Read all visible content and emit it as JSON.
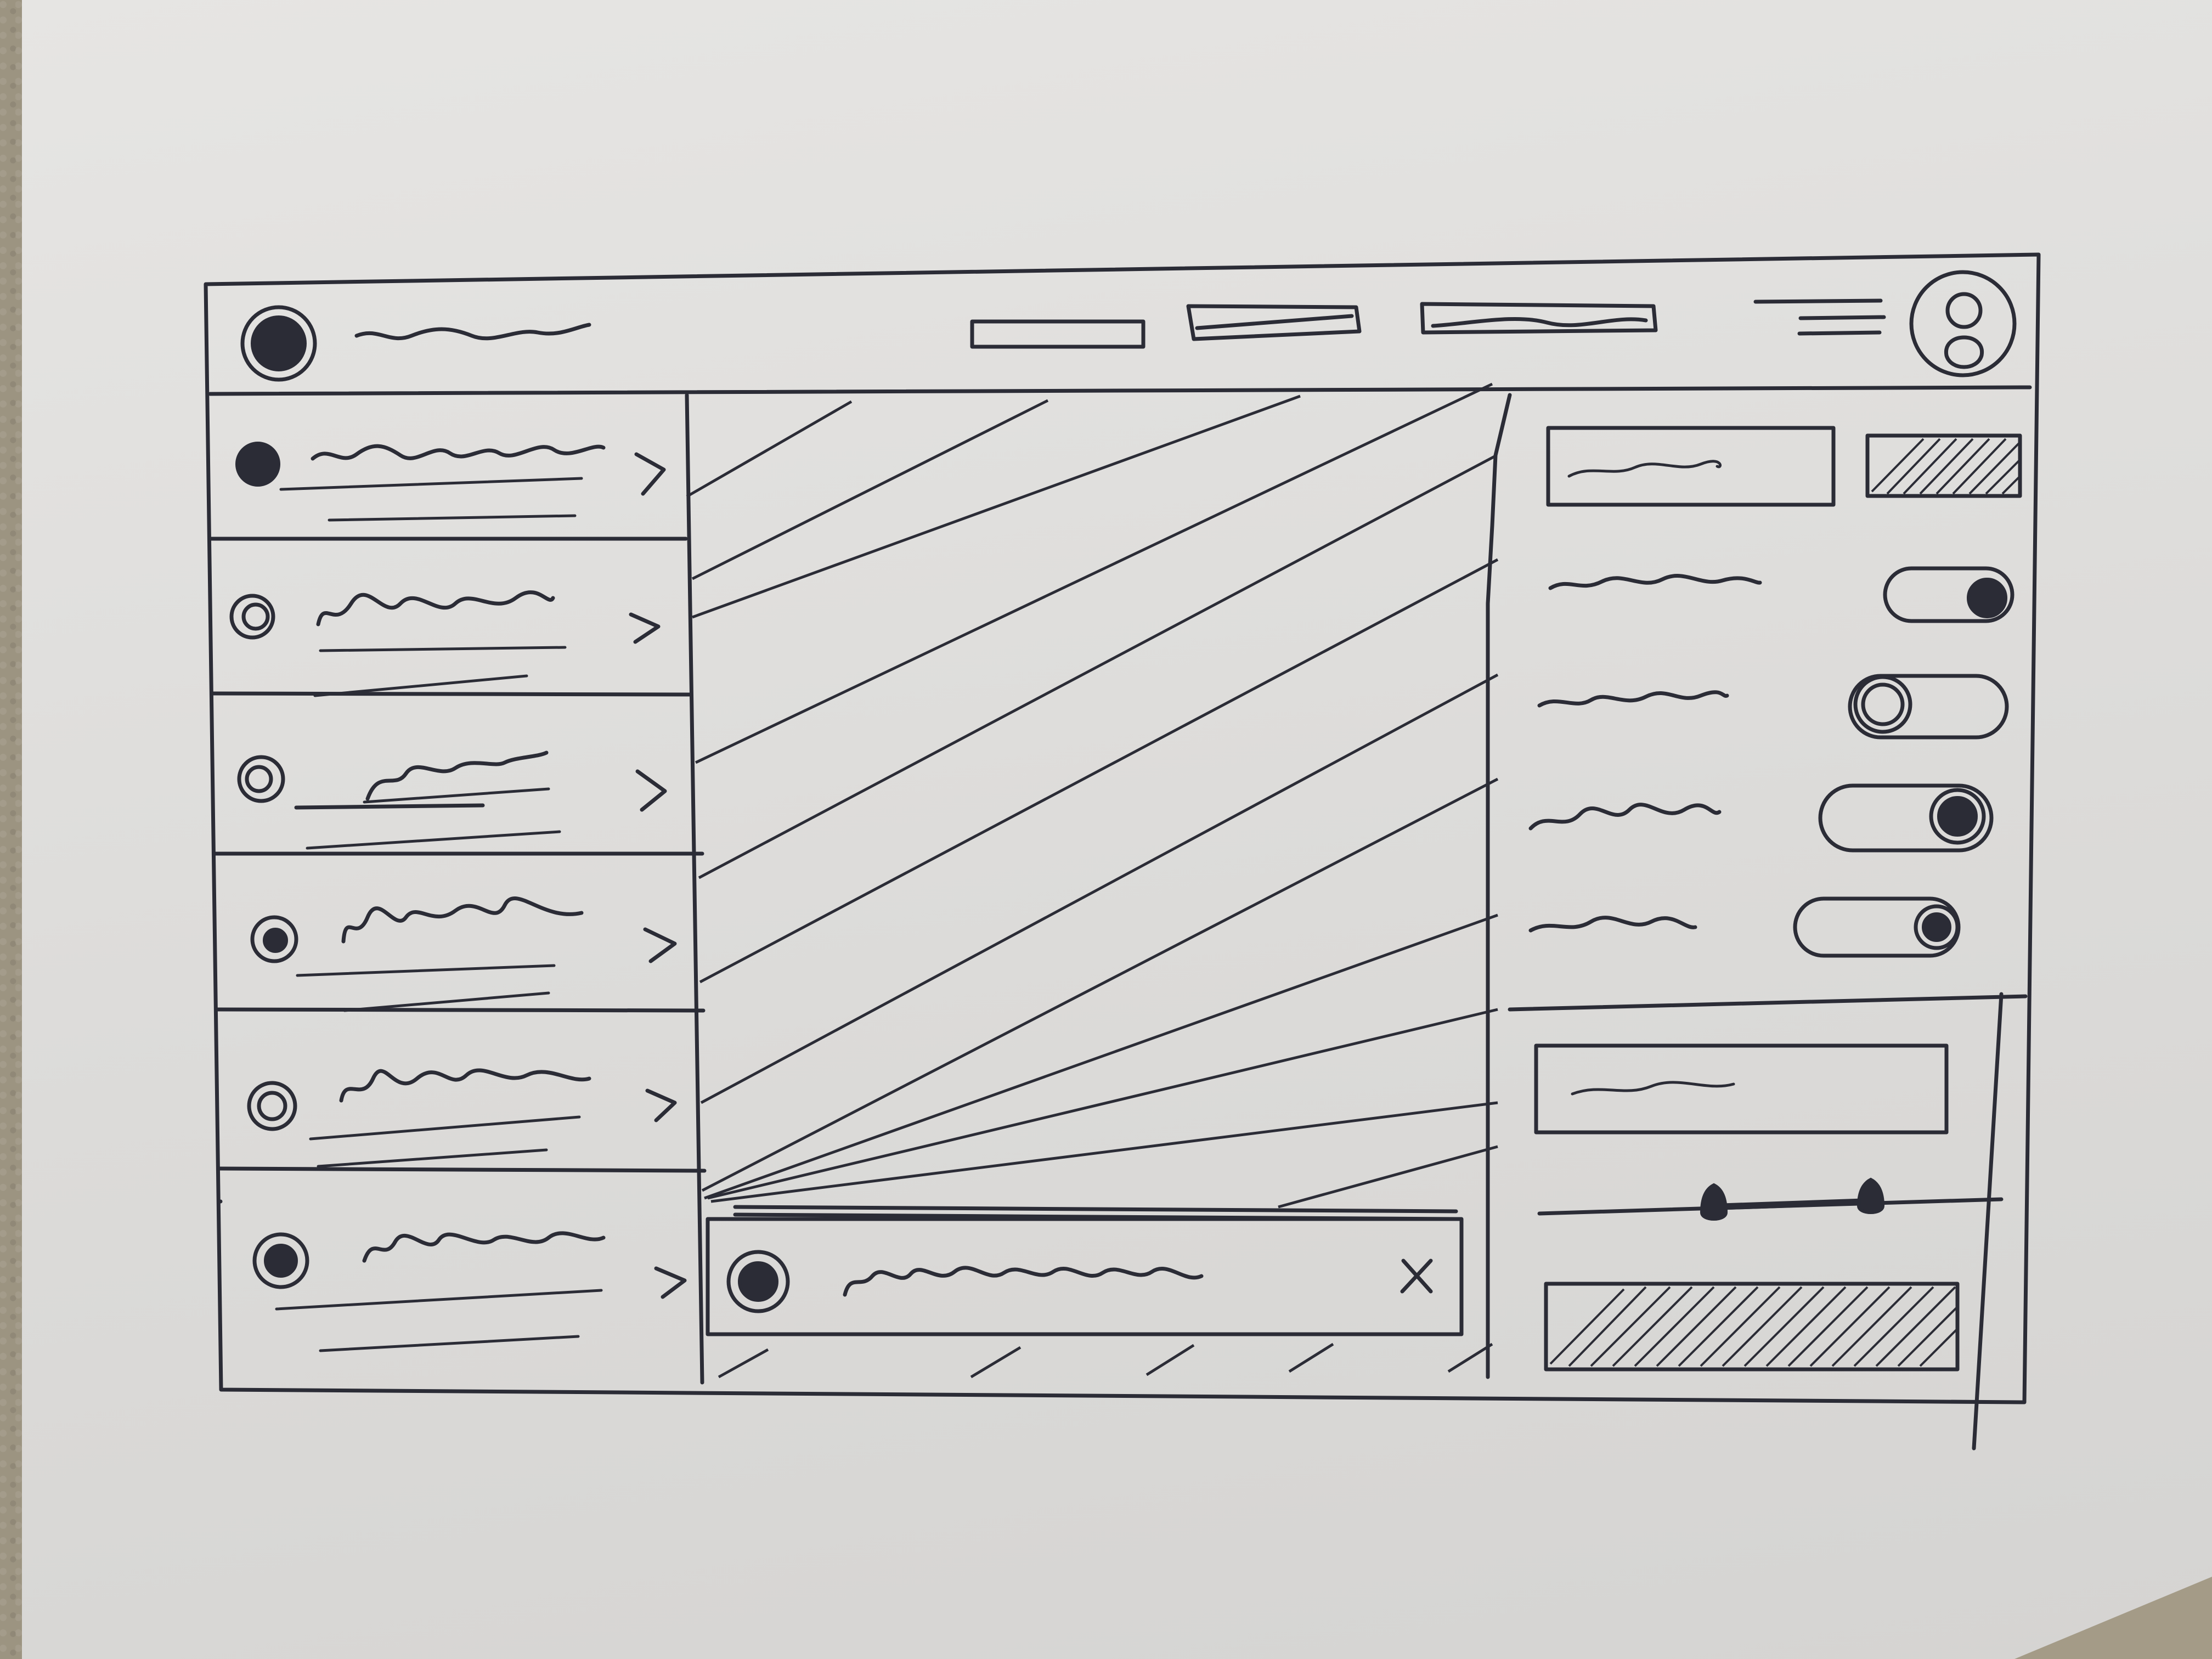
{
  "app": {
    "logo_icon": "logo-icon",
    "title_icon": "title-squiggle"
  },
  "header": {
    "nav_items": [
      "nav-item-1",
      "nav-item-2",
      "nav-item-3"
    ],
    "menu_icon": "menu-icon",
    "avatar_icon": "user-avatar-icon"
  },
  "sidebar": {
    "item_count": 6,
    "item_icon": "avatar-icon",
    "chevron_icon": "chevron-right-icon"
  },
  "main": {
    "content": "image-placeholder",
    "notification": {
      "icon": "notification-icon",
      "close_icon": "close-icon",
      "close_label": "X"
    }
  },
  "settings_panel": {
    "input_icon": "text-input",
    "action_button": "primary-button",
    "toggles": [
      {
        "state": "on"
      },
      {
        "state": "off"
      },
      {
        "state": "on"
      },
      {
        "state": "on"
      }
    ],
    "range_slider": {
      "low": 0.36,
      "high": 0.76
    },
    "submit_button": "submit-button"
  },
  "colors": {
    "ink": "#2b2c36",
    "paper": "#dcdbd9",
    "carpet": "#9c9481"
  }
}
